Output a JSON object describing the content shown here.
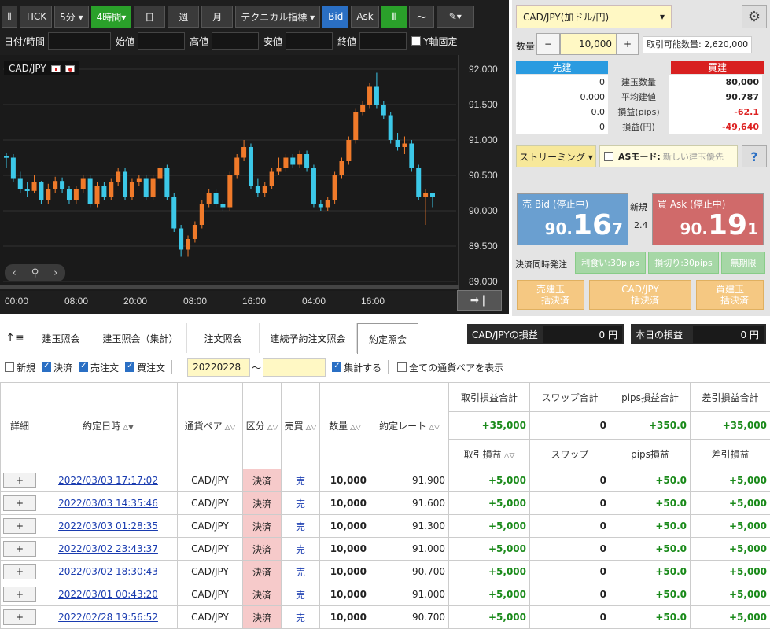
{
  "toolbar": {
    "tick": "TICK",
    "period5": "5分 ▾",
    "period4h": "4時間▾",
    "day": "日",
    "week": "週",
    "month": "月",
    "tech": "テクニカル指標 ▾",
    "bid": "Bid",
    "ask": "Ask"
  },
  "ohlc": {
    "datetime": "日付/時間",
    "open": "始値",
    "high": "高値",
    "low": "安値",
    "close": "終値",
    "yfix": "Y軸固定"
  },
  "chart_data": {
    "type": "candlestick",
    "pair": "CAD/JPY",
    "ylim": [
      89.0,
      92.0
    ],
    "yticks": [
      "92.000",
      "91.500",
      "91.000",
      "90.500",
      "90.000",
      "89.500",
      "89.000"
    ],
    "xticks": [
      "00:00",
      "08:00",
      "20:00",
      "08:00",
      "16:00",
      "04:00",
      "16:00"
    ],
    "candles": [
      [
        90.77,
        90.75,
        90.6,
        90.82
      ],
      [
        90.75,
        90.45,
        90.4,
        90.8
      ],
      [
        90.45,
        90.3,
        90.25,
        90.55
      ],
      [
        90.3,
        90.28,
        90.2,
        90.4
      ],
      [
        90.28,
        90.4,
        90.25,
        90.5
      ],
      [
        90.4,
        90.15,
        90.1,
        90.42
      ],
      [
        90.15,
        90.3,
        90.1,
        90.38
      ],
      [
        90.3,
        90.42,
        90.25,
        90.48
      ],
      [
        90.42,
        90.3,
        90.25,
        90.47
      ],
      [
        90.3,
        90.15,
        90.1,
        90.35
      ],
      [
        90.15,
        90.3,
        90.1,
        90.35
      ],
      [
        90.3,
        90.45,
        90.25,
        90.5
      ],
      [
        90.45,
        90.1,
        90.05,
        90.5
      ],
      [
        90.1,
        90.35,
        90.05,
        90.4
      ],
      [
        90.35,
        90.2,
        90.15,
        90.4
      ],
      [
        90.2,
        90.4,
        90.15,
        90.45
      ],
      [
        90.4,
        90.55,
        90.35,
        90.6
      ],
      [
        90.55,
        90.2,
        90.15,
        90.6
      ],
      [
        90.2,
        90.4,
        90.15,
        90.45
      ],
      [
        90.4,
        90.45,
        90.35,
        90.5
      ],
      [
        90.45,
        90.2,
        90.15,
        90.5
      ],
      [
        90.2,
        90.45,
        90.15,
        90.5
      ],
      [
        90.45,
        90.6,
        90.4,
        90.65
      ],
      [
        90.6,
        90.2,
        90.15,
        90.65
      ],
      [
        90.2,
        89.75,
        89.7,
        90.25
      ],
      [
        89.75,
        89.45,
        89.35,
        89.8
      ],
      [
        89.45,
        89.6,
        89.35,
        89.65
      ],
      [
        89.6,
        89.8,
        89.55,
        89.85
      ],
      [
        89.8,
        90.1,
        89.75,
        90.15
      ],
      [
        90.1,
        90.25,
        90.05,
        90.3
      ],
      [
        90.25,
        90.1,
        90.05,
        90.3
      ],
      [
        90.1,
        90.05,
        90.0,
        90.15
      ],
      [
        90.05,
        90.5,
        90.0,
        90.55
      ],
      [
        90.5,
        90.75,
        90.45,
        90.8
      ],
      [
        90.75,
        90.9,
        90.7,
        91.0
      ],
      [
        90.9,
        90.35,
        90.3,
        90.95
      ],
      [
        90.35,
        90.25,
        90.2,
        90.45
      ],
      [
        90.25,
        90.35,
        90.2,
        90.4
      ],
      [
        90.35,
        90.55,
        90.3,
        90.6
      ],
      [
        90.55,
        90.6,
        90.5,
        90.75
      ],
      [
        90.6,
        90.75,
        90.55,
        90.8
      ],
      [
        90.75,
        90.65,
        90.6,
        90.8
      ],
      [
        90.65,
        90.8,
        90.6,
        90.85
      ],
      [
        90.8,
        90.6,
        90.55,
        90.85
      ],
      [
        90.6,
        90.1,
        90.05,
        90.65
      ],
      [
        90.1,
        90.05,
        90.0,
        90.15
      ],
      [
        90.05,
        90.15,
        90.0,
        90.2
      ],
      [
        90.15,
        90.5,
        90.1,
        90.55
      ],
      [
        90.5,
        90.7,
        90.45,
        90.75
      ],
      [
        90.7,
        91.0,
        90.65,
        91.05
      ],
      [
        91.0,
        91.4,
        90.95,
        91.45
      ],
      [
        91.4,
        91.5,
        91.35,
        91.55
      ],
      [
        91.5,
        91.75,
        91.45,
        91.8
      ],
      [
        91.75,
        91.5,
        91.45,
        91.95
      ],
      [
        91.5,
        91.35,
        91.3,
        91.55
      ],
      [
        91.35,
        91.0,
        90.95,
        91.4
      ],
      [
        91.0,
        90.9,
        90.85,
        91.1
      ],
      [
        90.9,
        90.95,
        90.8,
        91.05
      ],
      [
        90.95,
        90.6,
        90.55,
        91.0
      ],
      [
        90.6,
        90.2,
        90.15,
        90.65
      ],
      [
        90.2,
        90.25,
        89.8,
        90.3
      ],
      [
        90.25,
        90.2,
        90.05,
        90.25
      ]
    ]
  },
  "order": {
    "symbol": "CAD/JPY(加ドル/円)",
    "qty_label": "数量",
    "qty_minus": "−",
    "qty": "10,000",
    "qty_plus": "+",
    "available": "取引可能数量: 2,620,000",
    "sell_hdr": "売建",
    "buy_hdr": "買建",
    "rows": [
      {
        "l": "0",
        "m": "建玉数量",
        "r": "80,000"
      },
      {
        "l": "0.000",
        "m": "平均建値",
        "r": "90.787"
      },
      {
        "l": "0.0",
        "m": "損益(pips)",
        "r": "-62.1"
      },
      {
        "l": "0",
        "m": "損益(円)",
        "r": "-49,640"
      }
    ],
    "streaming": "ストリーミング ▾",
    "as_label": "ASモード:",
    "as_value": "新しい建玉優先",
    "help": "?",
    "bid_label": "売 Bid (停止中)",
    "bid_int": "90.",
    "bid_big": "16",
    "bid_small": "7",
    "ask_label": "買 Ask (停止中)",
    "ask_int": "90.",
    "ask_big": "19",
    "ask_small": "1",
    "new_label": "新規",
    "spread": "2.4",
    "settle_label": "決済同時発注",
    "tp": "利食い:30pips",
    "sl": "損切り:30pips",
    "unlimited": "無期限",
    "bulk_sell": [
      "売建玉",
      "一括決済"
    ],
    "bulk_pair": [
      "CAD/JPY",
      "一括決済"
    ],
    "bulk_buy": [
      "買建玉",
      "一括決済"
    ]
  },
  "tabs": [
    "建玉照会",
    "建玉照会（集計）",
    "注文照会",
    "連続予約注文照会",
    "約定照会"
  ],
  "pl": {
    "pair_label": "CAD/JPYの損益",
    "pair_value": "0 円",
    "today_label": "本日の損益",
    "today_value": "0 円"
  },
  "filters": {
    "new": "新規",
    "settle": "決済",
    "sell": "売注文",
    "buy": "買注文",
    "date_from": "20220228",
    "date_to": "",
    "tilde": "〜",
    "aggregate": "集計する",
    "all_pairs": "全ての通貨ペアを表示"
  },
  "grid": {
    "h_detail": "詳細",
    "h_date": "約定日時",
    "h_pair": "通貨ペア",
    "h_kubun": "区分",
    "h_side": "売買",
    "h_qty": "数量",
    "h_rate": "約定レート",
    "h_tpl_sum": "取引損益合計",
    "h_swap_sum": "スワップ合計",
    "h_pips_sum": "pips損益合計",
    "h_net_sum": "差引損益合計",
    "sum_tpl": "+35,000",
    "sum_swap": "0",
    "sum_pips": "+350.0",
    "sum_net": "+35,000",
    "h_tpl": "取引損益",
    "h_swap": "スワップ",
    "h_pips": "pips損益",
    "h_net": "差引損益",
    "rows": [
      {
        "btn": "+",
        "date": "2022/03/03 17:17:02",
        "pair": "CAD/JPY",
        "kubun": "決済",
        "side": "売",
        "qty": "10,000",
        "rate": "91.900",
        "tpl": "+5,000",
        "swap": "0",
        "pips": "+50.0",
        "net": "+5,000"
      },
      {
        "btn": "+",
        "date": "2022/03/03 14:35:46",
        "pair": "CAD/JPY",
        "kubun": "決済",
        "side": "売",
        "qty": "10,000",
        "rate": "91.600",
        "tpl": "+5,000",
        "swap": "0",
        "pips": "+50.0",
        "net": "+5,000"
      },
      {
        "btn": "+",
        "date": "2022/03/03 01:28:35",
        "pair": "CAD/JPY",
        "kubun": "決済",
        "side": "売",
        "qty": "10,000",
        "rate": "91.300",
        "tpl": "+5,000",
        "swap": "0",
        "pips": "+50.0",
        "net": "+5,000"
      },
      {
        "btn": "+",
        "date": "2022/03/02 23:43:37",
        "pair": "CAD/JPY",
        "kubun": "決済",
        "side": "売",
        "qty": "10,000",
        "rate": "91.000",
        "tpl": "+5,000",
        "swap": "0",
        "pips": "+50.0",
        "net": "+5,000"
      },
      {
        "btn": "+",
        "date": "2022/03/02 18:30:43",
        "pair": "CAD/JPY",
        "kubun": "決済",
        "side": "売",
        "qty": "10,000",
        "rate": "90.700",
        "tpl": "+5,000",
        "swap": "0",
        "pips": "+50.0",
        "net": "+5,000"
      },
      {
        "btn": "+",
        "date": "2022/03/01 00:43:20",
        "pair": "CAD/JPY",
        "kubun": "決済",
        "side": "売",
        "qty": "10,000",
        "rate": "91.000",
        "tpl": "+5,000",
        "swap": "0",
        "pips": "+50.0",
        "net": "+5,000"
      },
      {
        "btn": "+",
        "date": "2022/02/28 19:56:52",
        "pair": "CAD/JPY",
        "kubun": "決済",
        "side": "売",
        "qty": "10,000",
        "rate": "90.700",
        "tpl": "+5,000",
        "swap": "0",
        "pips": "+50.0",
        "net": "+5,000"
      }
    ]
  },
  "colors": {
    "up": "#f07a2a",
    "down": "#3cc8e8",
    "sell_panel": "#6a9fd0",
    "buy_panel": "#d06a6a"
  }
}
